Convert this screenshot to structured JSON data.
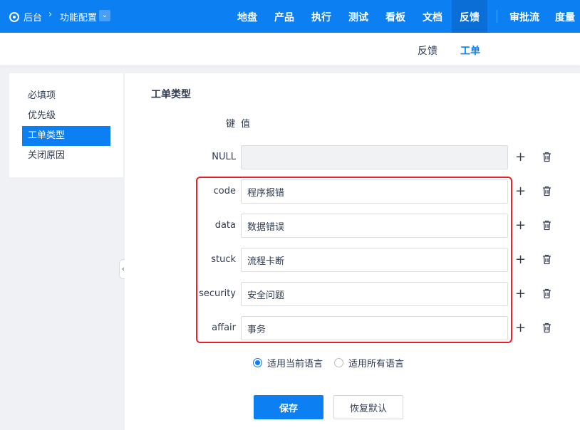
{
  "header": {
    "home_label": "后台",
    "breadcrumb_sep": "›",
    "current_module": "功能配置",
    "dropdown_glyph": "⌄",
    "nav": [
      "地盘",
      "产品",
      "执行",
      "测试",
      "看板",
      "文档",
      "反馈",
      "审批流",
      "度量"
    ],
    "active_nav": "反馈"
  },
  "subnav": {
    "items": [
      "反馈",
      "工单"
    ],
    "active": "工单"
  },
  "sidebar": {
    "items": [
      "必填项",
      "优先级",
      "工单类型",
      "关闭原因"
    ],
    "active": "工单类型"
  },
  "collapse_glyph": "‹",
  "form": {
    "title": "工单类型",
    "key_header": "键",
    "value_header": "值",
    "rows": [
      {
        "key": "NULL",
        "value": ""
      },
      {
        "key": "code",
        "value": "程序报错"
      },
      {
        "key": "data",
        "value": "数据错误"
      },
      {
        "key": "stuck",
        "value": "流程卡断"
      },
      {
        "key": "security",
        "value": "安全问题"
      },
      {
        "key": "affair",
        "value": "事务"
      }
    ],
    "add_glyph": "+",
    "lang_options": [
      "适用当前语言",
      "适用所有语言"
    ],
    "selected_lang": "适用当前语言",
    "save_label": "保存",
    "reset_label": "恢复默认"
  },
  "colors": {
    "brand": "#0c7ff2",
    "highlight": "#e8212d"
  }
}
